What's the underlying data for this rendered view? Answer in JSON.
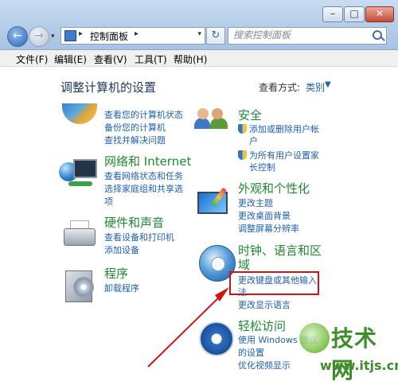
{
  "window": {
    "controls": {
      "minimize": "–",
      "maximize": "□",
      "close": "✕"
    },
    "nav": {
      "back": "←",
      "forward": "→",
      "dropdown": "▾"
    },
    "address": {
      "separator": "▸",
      "text": "控制面板",
      "trail": "▸",
      "dropdown": "▾"
    },
    "refresh": "↻",
    "search": {
      "placeholder": "搜索控制面板"
    }
  },
  "menu": [
    "文件(F)",
    "编辑(E)",
    "查看(V)",
    "工具(T)",
    "帮助(H)"
  ],
  "header": {
    "title": "调整计算机的设置",
    "view_label": "查看方式:",
    "view_value": "类别",
    "view_dropdown": "▼"
  },
  "categories_left": [
    {
      "title": "",
      "icon": "shield-computer-icon",
      "links": [
        "查看您的计算机状态",
        "备份您的计算机",
        "查找并解决问题"
      ]
    },
    {
      "title": "网络和 Internet",
      "icon": "network-icon",
      "links": [
        "查看网络状态和任务",
        "选择家庭组和共享选",
        "项"
      ]
    },
    {
      "title": "硬件和声音",
      "icon": "printer-icon",
      "links": [
        "查看设备和打印机",
        "添加设备"
      ]
    },
    {
      "title": "程序",
      "icon": "programs-icon",
      "links": [
        "卸载程序"
      ]
    }
  ],
  "categories_right": [
    {
      "title": "安全",
      "icon": "users-icon",
      "links": [
        "添加或删除用户帐",
        "户",
        "为所有用户设置家",
        "长控制"
      ]
    },
    {
      "title": "外观和个性化",
      "icon": "appearance-icon",
      "links": [
        "更改主题",
        "更改桌面背景",
        "调整屏幕分辨率"
      ]
    },
    {
      "title": "时钟、语言和区",
      "title2": "域",
      "icon": "clock-globe-icon",
      "links": [
        "更改键盘或其他输入",
        "法",
        "更改显示语言"
      ]
    },
    {
      "title": "轻松访问",
      "icon": "ease-of-access-icon",
      "links": [
        "使用 Windows 建议",
        "的设置",
        "优化视频显示"
      ]
    }
  ],
  "watermark": {
    "title": "技术网",
    "url": "www.itjs.cn"
  },
  "colors": {
    "link": "#1e5fb3",
    "category_title": "#1e8a31",
    "annotation": "#d11414"
  }
}
